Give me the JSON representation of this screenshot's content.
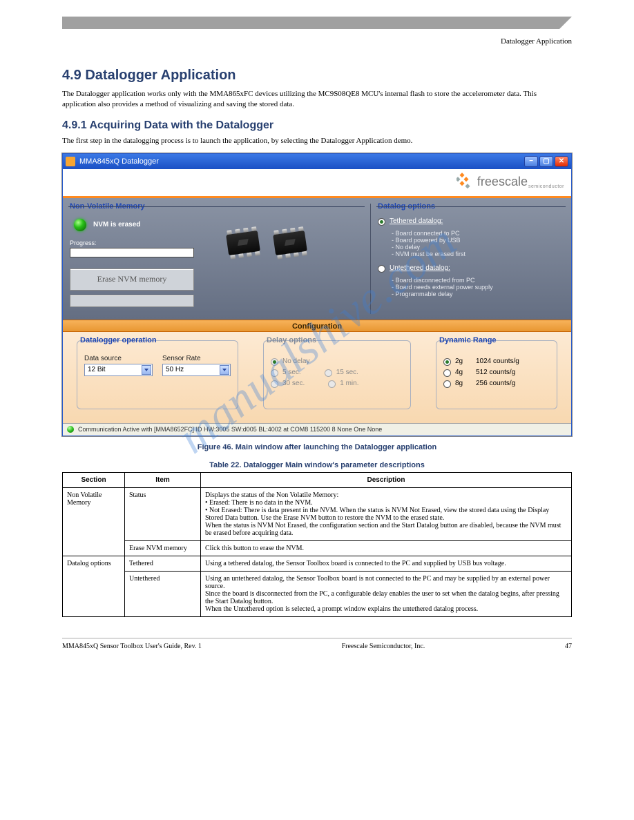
{
  "watermark": "manualshive.com",
  "page_header": {
    "left": "",
    "right": "Datalogger Application"
  },
  "h1": "4.9 Datalogger Application",
  "intro": "The Datalogger application works only with the MMA865xFC devices utilizing the MC9S08QE8 MCU's internal flash to store the accelerometer data. This application also provides a method of visualizing and saving the stored data.",
  "h2": "4.9.1 Acquiring Data with the Datalogger",
  "p2": "The first step in the datalogging process is to launch the application, by selecting the Datalogger Application demo.",
  "window": {
    "title": "MMA845xQ Datalogger",
    "brand": "freescale",
    "brand_sub": "semiconductor",
    "nvm_legend": "Non-Volatile Memory",
    "nvm_status": "NVM is erased",
    "progress_label": "Progress:",
    "erase_btn": "Erase NVM memory",
    "datalog_legend": "Datalog options",
    "tethered": {
      "title": "Tethered datalog:",
      "items": [
        "Board connected to PC",
        "Board powered by USB",
        "No delay",
        "NVM must be erased first"
      ]
    },
    "untethered": {
      "title": "Untethered datalog:",
      "items": [
        "Board disconnected from PC",
        "Board needs external power supply",
        "Programmable delay"
      ]
    },
    "config_bar": "Configuration",
    "datalogger_op": {
      "legend": "Datalogger operation",
      "data_source_label": "Data source",
      "data_source_value": "12 Bit",
      "sensor_rate_label": "Sensor Rate",
      "sensor_rate_value": "50 Hz"
    },
    "delay_options": {
      "legend": "Delay options",
      "rows": [
        [
          "No delay",
          ""
        ],
        [
          "5 sec.",
          "15 sec."
        ],
        [
          "30 sec.",
          "1 min."
        ]
      ]
    },
    "dynamic_range": {
      "legend": "Dynamic Range",
      "rows": [
        {
          "g": "2g",
          "c": "1024 counts/g",
          "sel": true
        },
        {
          "g": "4g",
          "c": "512 counts/g",
          "sel": false
        },
        {
          "g": "8g",
          "c": "256 counts/g",
          "sel": false
        }
      ]
    },
    "status": "Communication Active with [MMA8652FC] ID HW:3005 SW:d005 BL:4002 at COM8 115200 8 None One None"
  },
  "figure_caption": "Figure 46. Main window after launching the Datalogger application",
  "table_caption": "Table 22. Datalogger Main window's parameter descriptions",
  "table": {
    "headers": [
      "Section",
      "Item",
      "Description"
    ],
    "rows": [
      {
        "section": "Non Volatile Memory",
        "section_rowspan": 2,
        "item": "Status",
        "desc": "Displays the status of the Non Volatile Memory:\n• Erased: There is no data in the NVM.\n• Not Erased: There is data present in the NVM. When the status is NVM Not Erased, view the stored data using the Display Stored Data button. Use the Erase NVM button to restore the NVM to the erased state.\nWhen the status is NVM Not Erased, the configuration section and the Start Datalog button are disabled, because the NVM must be erased before acquiring data."
      },
      {
        "item": "Erase NVM memory",
        "desc": "Click this button to erase the NVM."
      },
      {
        "section": "Datalog options",
        "section_rowspan": 2,
        "item": "Tethered",
        "desc": "Using a tethered datalog, the Sensor Toolbox board is connected to the PC and supplied by USB bus voltage."
      },
      {
        "item": "Untethered",
        "desc": "Using an untethered datalog, the Sensor Toolbox board is not connected to the PC and may be supplied by an external power source.\nSince the board is disconnected from the PC, a configurable delay enables the user to set when the datalog begins, after pressing the Start Datalog button.\nWhen the Untethered option is selected, a prompt window explains the untethered datalog process."
      }
    ]
  },
  "footer": {
    "left": "MMA845xQ Sensor Toolbox User's Guide, Rev. 1",
    "mid": "Freescale Semiconductor, Inc.",
    "right": "47"
  }
}
